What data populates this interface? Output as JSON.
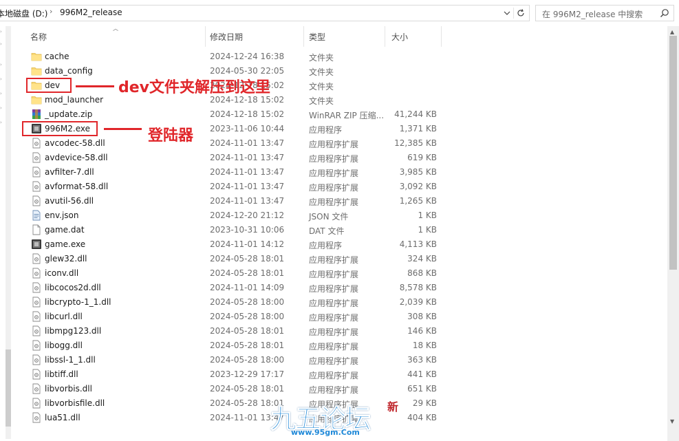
{
  "address": {
    "segments": [
      "本地磁盘 (D:)",
      "996M2_release"
    ],
    "separator": "›"
  },
  "search": {
    "placeholder": "在 996M2_release 中搜索"
  },
  "columns": {
    "name": "名称",
    "date": "修改日期",
    "type": "类型",
    "size": "大小"
  },
  "files": [
    {
      "name": "cache",
      "date": "2024-12-24 16:38",
      "type": "文件夹",
      "size": "",
      "icon": "folder-icon"
    },
    {
      "name": "data_config",
      "date": "2024-05-30 22:05",
      "type": "文件夹",
      "size": "",
      "icon": "folder-icon"
    },
    {
      "name": "dev",
      "date": "2024-12-18 15:02",
      "type": "文件夹",
      "size": "",
      "icon": "folder-icon"
    },
    {
      "name": "mod_launcher",
      "date": "2024-12-18 15:02",
      "type": "文件夹",
      "size": "",
      "icon": "folder-icon"
    },
    {
      "name": "_update.zip",
      "date": "2024-12-18 15:02",
      "type": "WinRAR ZIP 压缩...",
      "size": "41,244 KB",
      "icon": "winrar-archive-icon"
    },
    {
      "name": "996M2.exe",
      "date": "2023-11-06 10:44",
      "type": "应用程序",
      "size": "1,371 KB",
      "icon": "application-icon"
    },
    {
      "name": "avcodec-58.dll",
      "date": "2024-11-01 13:47",
      "type": "应用程序扩展",
      "size": "12,385 KB",
      "icon": "dll-file-icon"
    },
    {
      "name": "avdevice-58.dll",
      "date": "2024-11-01 13:47",
      "type": "应用程序扩展",
      "size": "619 KB",
      "icon": "dll-file-icon"
    },
    {
      "name": "avfilter-7.dll",
      "date": "2024-11-01 13:47",
      "type": "应用程序扩展",
      "size": "3,985 KB",
      "icon": "dll-file-icon"
    },
    {
      "name": "avformat-58.dll",
      "date": "2024-11-01 13:47",
      "type": "应用程序扩展",
      "size": "3,092 KB",
      "icon": "dll-file-icon"
    },
    {
      "name": "avutil-56.dll",
      "date": "2024-11-01 13:47",
      "type": "应用程序扩展",
      "size": "1,265 KB",
      "icon": "dll-file-icon"
    },
    {
      "name": "env.json",
      "date": "2024-12-20 21:12",
      "type": "JSON 文件",
      "size": "1 KB",
      "icon": "json-file-icon"
    },
    {
      "name": "game.dat",
      "date": "2023-10-31 10:06",
      "type": "DAT 文件",
      "size": "1 KB",
      "icon": "blank-file-icon"
    },
    {
      "name": "game.exe",
      "date": "2024-11-01 14:12",
      "type": "应用程序",
      "size": "4,113 KB",
      "icon": "application-icon"
    },
    {
      "name": "glew32.dll",
      "date": "2024-05-28 18:01",
      "type": "应用程序扩展",
      "size": "324 KB",
      "icon": "dll-file-icon"
    },
    {
      "name": "iconv.dll",
      "date": "2024-05-28 18:01",
      "type": "应用程序扩展",
      "size": "868 KB",
      "icon": "dll-file-icon"
    },
    {
      "name": "libcocos2d.dll",
      "date": "2024-11-01 14:09",
      "type": "应用程序扩展",
      "size": "8,578 KB",
      "icon": "dll-file-icon"
    },
    {
      "name": "libcrypto-1_1.dll",
      "date": "2024-05-28 18:00",
      "type": "应用程序扩展",
      "size": "2,039 KB",
      "icon": "dll-file-icon"
    },
    {
      "name": "libcurl.dll",
      "date": "2024-05-28 18:00",
      "type": "应用程序扩展",
      "size": "308 KB",
      "icon": "dll-file-icon"
    },
    {
      "name": "libmpg123.dll",
      "date": "2024-05-28 18:01",
      "type": "应用程序扩展",
      "size": "146 KB",
      "icon": "dll-file-icon"
    },
    {
      "name": "libogg.dll",
      "date": "2024-05-28 18:01",
      "type": "应用程序扩展",
      "size": "18 KB",
      "icon": "dll-file-icon"
    },
    {
      "name": "libssl-1_1.dll",
      "date": "2024-05-28 18:00",
      "type": "应用程序扩展",
      "size": "363 KB",
      "icon": "dll-file-icon"
    },
    {
      "name": "libtiff.dll",
      "date": "2023-12-29 17:17",
      "type": "应用程序扩展",
      "size": "441 KB",
      "icon": "dll-file-icon"
    },
    {
      "name": "libvorbis.dll",
      "date": "2024-05-28 18:01",
      "type": "应用程序扩展",
      "size": "651 KB",
      "icon": "dll-file-icon"
    },
    {
      "name": "libvorbisfile.dll",
      "date": "2024-05-28 18:01",
      "type": "应用程序扩展",
      "size": "29 KB",
      "icon": "dll-file-icon"
    },
    {
      "name": "lua51.dll",
      "date": "2024-11-01 13:47",
      "type": "应用程序扩展",
      "size": "404 KB",
      "icon": "dll-file-icon"
    }
  ],
  "annotations": {
    "dev_note": "dev文件夹解压到这里",
    "launcher_note": "登陆器",
    "color": "#e0262a"
  },
  "watermark": {
    "logo_text": "九五论坛",
    "url": "www.95gm.Com",
    "stamp": "新"
  }
}
